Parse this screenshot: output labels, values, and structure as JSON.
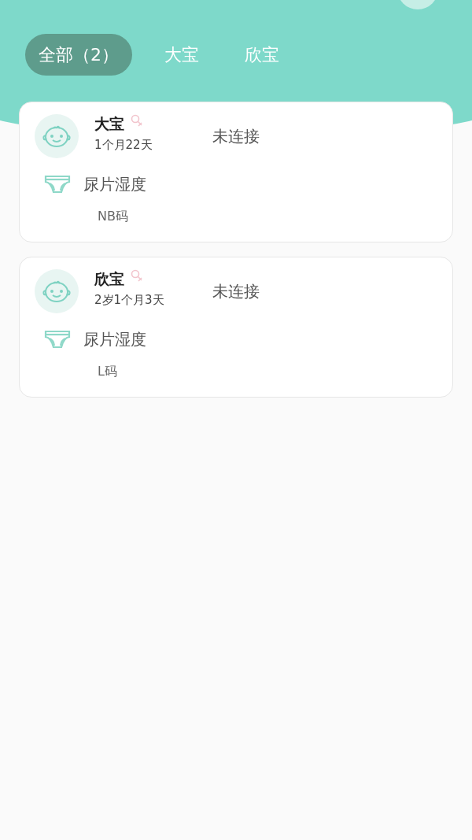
{
  "tabs": [
    {
      "label": "全部（2）",
      "selected": true
    },
    {
      "label": "大宝",
      "selected": false
    },
    {
      "label": "欣宝",
      "selected": false
    }
  ],
  "babies": [
    {
      "name": "大宝",
      "age": "1个月22天",
      "status": "未连接",
      "metric": "尿片湿度",
      "size": "NB码"
    },
    {
      "name": "欣宝",
      "age": "2岁1个月3天",
      "status": "未连接",
      "metric": "尿片湿度",
      "size": "L码"
    }
  ]
}
